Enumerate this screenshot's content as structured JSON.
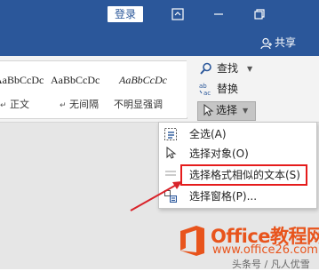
{
  "titlebar": {
    "login_label": "登录",
    "share_label": "共享",
    "icons": [
      "ribbon-display-options-icon",
      "minimize-icon",
      "restore-icon"
    ]
  },
  "colors": {
    "titlebar": "#2b579a",
    "ribbon": "#f3f3f3",
    "highlight": "#e51c1c",
    "arrow": "#d9232a",
    "watermark": "#e8541c"
  },
  "styles_gallery": [
    {
      "sample": "AaBbCcDc",
      "name": "正文"
    },
    {
      "sample": "AaBbCcDc",
      "name": "无间隔"
    },
    {
      "sample": "AaBbCcDc",
      "name": "不明显强调"
    }
  ],
  "editing": {
    "find_label": "查找",
    "replace_label": "替换",
    "select_label": "选择"
  },
  "select_menu": [
    {
      "label": "全选(A)",
      "icon": "select-all-icon"
    },
    {
      "label": "选择对象(O)",
      "icon": "select-objects-icon"
    },
    {
      "label": "选择格式相似的文本(S)",
      "icon": "select-similar-text-icon"
    },
    {
      "label": "选择窗格(P)...",
      "icon": "selection-pane-icon"
    }
  ],
  "watermark": {
    "title": "Office教程网",
    "url": "www.office26.com",
    "credit": "头条号 / 凡人优雪"
  }
}
